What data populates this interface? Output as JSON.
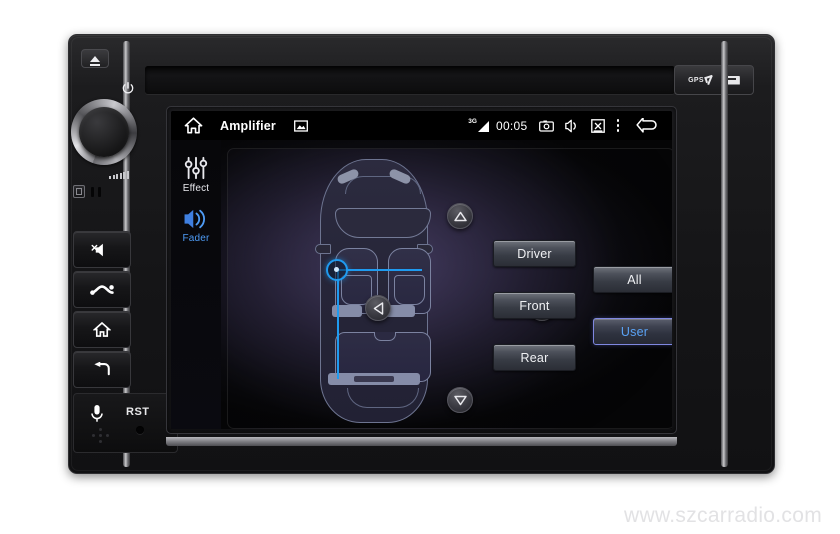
{
  "device": {
    "gps_label": "GPS",
    "sd_label": "SD",
    "rst_label": "RST",
    "buttons": [
      {
        "name": "eject",
        "icon": "eject-icon"
      },
      {
        "name": "power",
        "icon": "power-icon"
      },
      {
        "name": "volume-knob",
        "icon": "rotary-knob"
      },
      {
        "name": "mute",
        "icon": "mute-speaker-icon"
      },
      {
        "name": "phone",
        "icon": "phone-handset-icon"
      },
      {
        "name": "home",
        "icon": "home-icon"
      },
      {
        "name": "back",
        "icon": "back-arrow-icon"
      },
      {
        "name": "microphone",
        "icon": "microphone-icon"
      },
      {
        "name": "reset",
        "icon": "reset-pinhole"
      }
    ]
  },
  "statusbar": {
    "home_icon": "home-icon",
    "title": "Amplifier",
    "wallpaper_icon": "wallpaper-icon",
    "network_label": "3G",
    "signal_icon": "signal-bars-icon",
    "clock": "00:05",
    "camera_icon": "camera-icon",
    "speaker_icon": "speaker-icon",
    "close_box_icon": "close-box-icon",
    "overflow_icon": "overflow-menu-icon",
    "back_icon": "back-arrow-icon"
  },
  "sidebar": {
    "items": [
      {
        "label": "Effect",
        "icon": "equalizer-sliders-icon",
        "selected": false
      },
      {
        "label": "Fader",
        "icon": "speaker-waves-icon",
        "selected": true
      }
    ]
  },
  "fader": {
    "panel_name": "car-cabin-fader-panel",
    "nav": {
      "up": "nav-up-arrow",
      "down": "nav-down-arrow",
      "left": "nav-left-arrow",
      "right": "nav-right-arrow"
    },
    "marker": {
      "name": "fader-position-marker",
      "position": "front-left"
    },
    "presets_left": [
      {
        "label": "Driver",
        "selected": false
      },
      {
        "label": "Front",
        "selected": false
      },
      {
        "label": "Rear",
        "selected": false
      }
    ],
    "presets_right": [
      {
        "label": "All",
        "selected": false
      },
      {
        "label": "User",
        "selected": true
      }
    ]
  },
  "colors": {
    "accent_blue": "#1f9bf0",
    "selected_text": "#5aa2f4",
    "selected_border": "#7f87e0",
    "panel_purple": "#2b2640",
    "screen_black": "#000000"
  },
  "watermark": {
    "text": "www.szcarradio.com"
  }
}
